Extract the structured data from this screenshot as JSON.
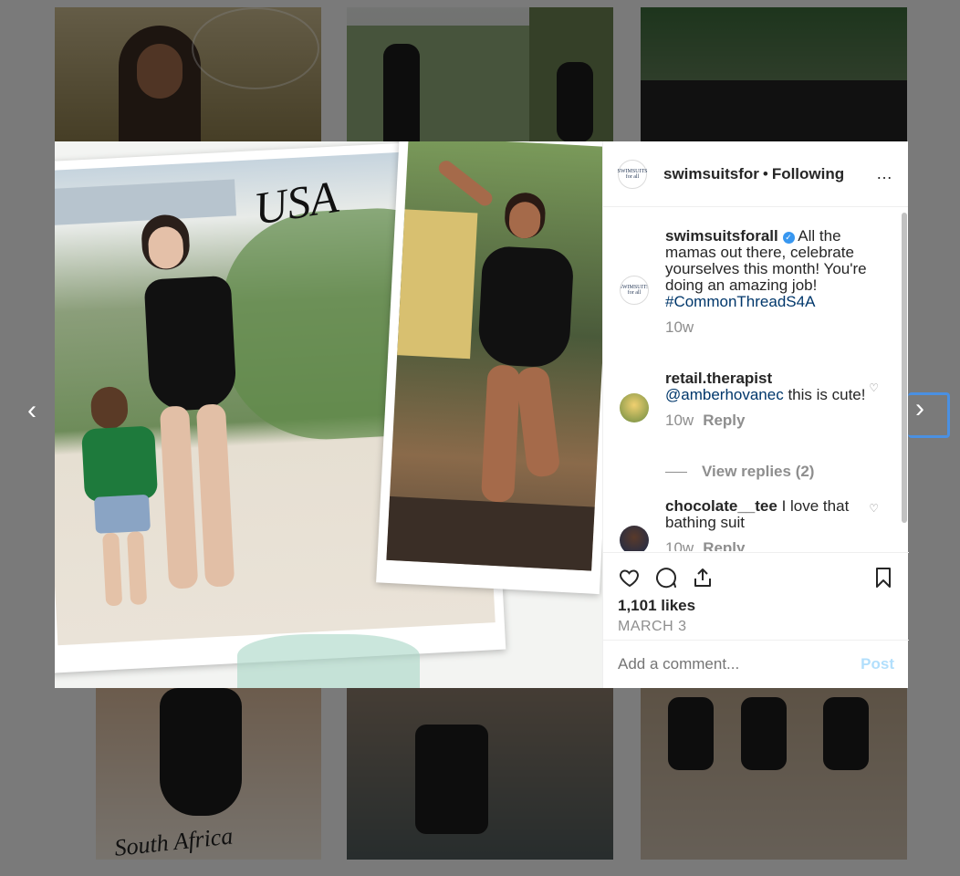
{
  "post": {
    "username": "swimsuitsfor",
    "separator": "•",
    "follow_status": "Following",
    "more_icon": "…",
    "logo_text": "SWIMSUITS for all"
  },
  "media": {
    "caption_top": "USA",
    "caption_bottom": "South Africa"
  },
  "comments": [
    {
      "username": "swimsuitsforall",
      "verified": true,
      "text": "All the mamas out there, celebrate yourselves this month! You're doing an amazing job!",
      "hashtag": "#CommonThreadS4A",
      "time": "10w"
    },
    {
      "username": "retail.therapist",
      "mention": "@amberhovanec",
      "text": "this is cute!",
      "time": "10w",
      "reply": "Reply",
      "view_replies": "View replies (2)"
    },
    {
      "username": "chocolate__tee",
      "text": "I love that bathing suit",
      "time": "10w",
      "reply": "Reply"
    }
  ],
  "stats": {
    "likes": "1,101 likes",
    "date": "MARCH 3"
  },
  "composer": {
    "placeholder": "Add a comment...",
    "post_label": "Post"
  },
  "colors": {
    "link": "#00376b",
    "verified": "#3897f0",
    "post_disabled": "#b2dffc",
    "nav_focus": "#4a90e2"
  }
}
